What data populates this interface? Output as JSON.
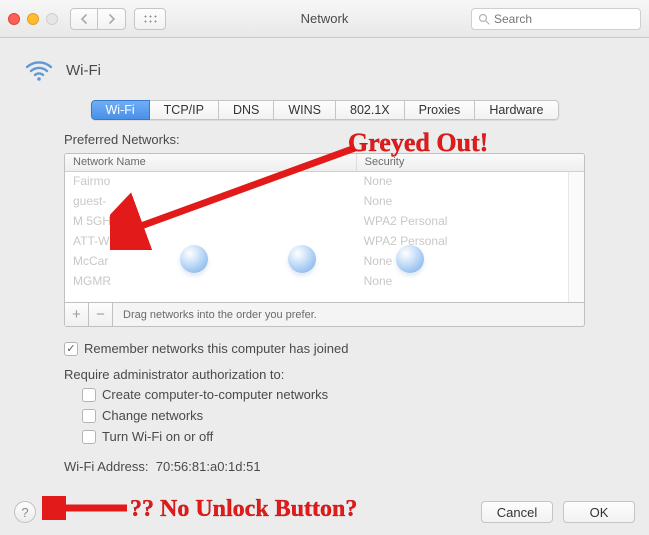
{
  "window": {
    "title": "Network",
    "search_placeholder": "Search"
  },
  "page": {
    "heading": "Wi-Fi"
  },
  "tabs": [
    {
      "id": "wifi",
      "label": "Wi-Fi",
      "active": true
    },
    {
      "id": "tcpip",
      "label": "TCP/IP",
      "active": false
    },
    {
      "id": "dns",
      "label": "DNS",
      "active": false
    },
    {
      "id": "wins",
      "label": "WINS",
      "active": false
    },
    {
      "id": "8021x",
      "label": "802.1X",
      "active": false
    },
    {
      "id": "proxies",
      "label": "Proxies",
      "active": false
    },
    {
      "id": "hardware",
      "label": "Hardware",
      "active": false
    }
  ],
  "preferred": {
    "label": "Preferred Networks:",
    "columns": {
      "name": "Network Name",
      "security": "Security"
    },
    "rows": [
      {
        "name": "Fairmo",
        "security": "None"
      },
      {
        "name": "guest-",
        "security": "None"
      },
      {
        "name": "M 5GH",
        "security": "WPA2 Personal"
      },
      {
        "name": "ATT-W",
        "security": "WPA2 Personal"
      },
      {
        "name": "McCar",
        "security": "None"
      },
      {
        "name": "MGMR",
        "security": "None"
      }
    ],
    "add_label": "+",
    "remove_label": "−",
    "drag_hint": "Drag networks into the order you prefer."
  },
  "options": {
    "remember": {
      "label": "Remember networks this computer has joined",
      "checked": true
    },
    "admin_label": "Require administrator authorization to:",
    "create_ctc": {
      "label": "Create computer-to-computer networks",
      "checked": false
    },
    "change_net": {
      "label": "Change networks",
      "checked": false
    },
    "turn_wifi": {
      "label": "Turn Wi-Fi on or off",
      "checked": false
    }
  },
  "wifi_address": {
    "label": "Wi-Fi Address:",
    "value": "70:56:81:a0:1d:51"
  },
  "buttons": {
    "cancel": "Cancel",
    "ok": "OK",
    "help": "?"
  },
  "annotations": {
    "greyed": "Greyed Out!",
    "no_unlock": "?? No Unlock Button?"
  }
}
